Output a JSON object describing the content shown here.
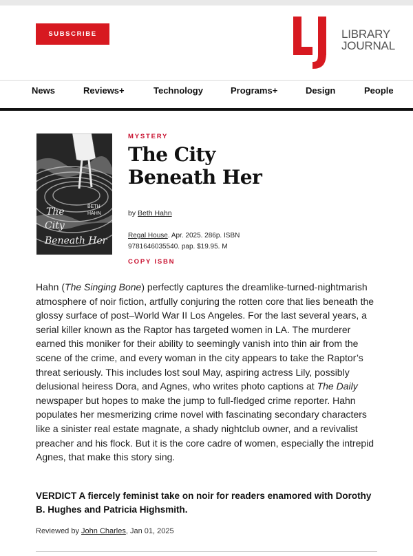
{
  "header": {
    "subscribe_label": "SUBSCRIBE",
    "logo_letters": "LJ",
    "logo_line1": "LIBRARY",
    "logo_line2": "JOURNAL",
    "brand_color": "#d71920"
  },
  "nav": {
    "items": [
      {
        "label": "News"
      },
      {
        "label": "Reviews+"
      },
      {
        "label": "Technology"
      },
      {
        "label": "Programs+"
      },
      {
        "label": "Design"
      },
      {
        "label": "People"
      }
    ]
  },
  "review": {
    "genre": "MYSTERY",
    "title_line1": "The City",
    "title_line2": "Beneath Her",
    "by_prefix": "by",
    "author": "Beth Hahn",
    "publisher": "Regal House",
    "pub_details_1": ". Apr. 2025. 286p. ISBN",
    "pub_details_2": "9781646035540. pap. $19.95. M",
    "copy_isbn": "COPY ISBN",
    "cover": {
      "author_line1": "BETH",
      "author_line2": "HAHN",
      "title_line1": "The",
      "title_line2": "City",
      "title_line3": "Beneath Her"
    },
    "body": {
      "p1": "Hahn (",
      "p1_em": "The Singing Bone",
      "p2": ") perfectly captures the dreamlike-turned-nightmarish atmosphere of noir fiction, artfully conjuring the rotten core that lies beneath the glossy surface of post–World War II Los Angeles. For the last several years, a serial killer known as the Raptor has targeted women in LA. The murderer earned this moniker for their ability to seemingly vanish into thin air from the scene of the crime, and every woman in the city appears to take the Raptor’s threat seriously. This includes lost soul May, aspiring actress Lily, possibly delusional heiress Dora, and Agnes, who writes photo captions at ",
      "p2_em": "The Daily",
      "p3": " newspaper but hopes to make the jump to full-fledged crime reporter. Hahn populates her mesmerizing crime novel with fascinating secondary characters like a sinister real estate magnate, a shady nightclub owner, and a revivalist preacher and his flock. But it is the core cadre of women, especially the intrepid Agnes, that make this story sing."
    },
    "verdict": "VERDICT A fiercely feminist take on noir for readers enamored with Dorothy B. Hughes and Patricia Highsmith.",
    "reviewed_prefix": "Reviewed by",
    "reviewer": "John Charles",
    "review_date": ", Jan 01, 2025"
  }
}
